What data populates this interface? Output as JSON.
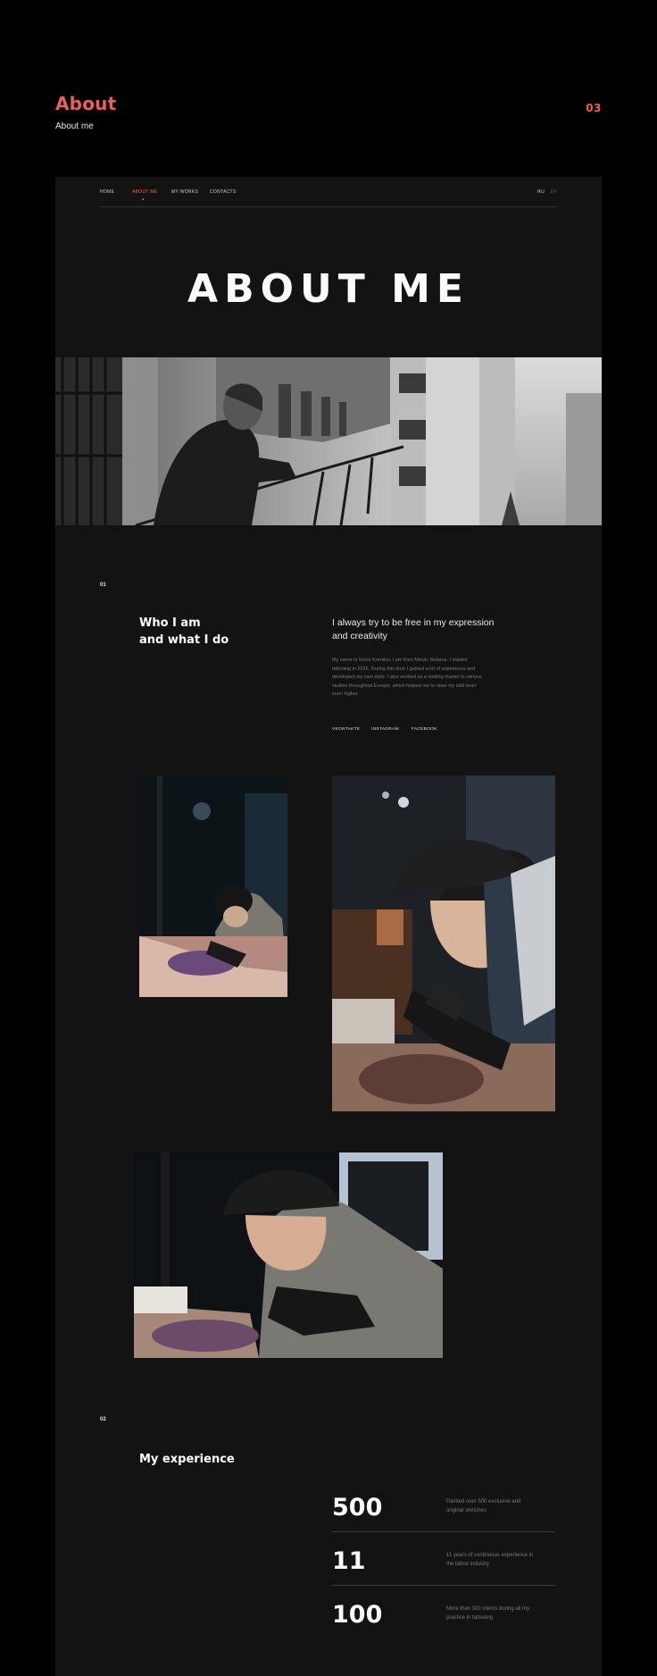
{
  "page": {
    "title": "About",
    "subtitle": "About me",
    "number": "03"
  },
  "nav": {
    "items": [
      "HOME",
      "ABOUT ME",
      "MY WORKS",
      "CONTACTS"
    ],
    "active_index": 1,
    "languages": [
      "RU",
      "EN"
    ]
  },
  "hero": {
    "heading": "ABOUT ME"
  },
  "section1": {
    "number": "01",
    "heading_line1": "Who I am",
    "heading_line2": "and what I do",
    "lead": "I always try to be free in my expression and creativity",
    "body": "My name is Victor Kornilov, I am from Minsk, Belarus. I started tattooing in 2016. During this time I gained a lot of experience and developed my own style. I also worked as a visiting master in various studios throughout Europe, which helped me to raise my skill level even higher.",
    "socials": [
      "VKONTAKTE",
      "INSTAGRAM",
      "FACEBOOK"
    ]
  },
  "section2": {
    "number": "02",
    "heading": "My experience",
    "stats": [
      {
        "value": "500",
        "description": "Painted over 500 exclusive and original sketches"
      },
      {
        "value": "11",
        "description": "11 years of continuous experience in the tattoo industry"
      },
      {
        "value": "100",
        "description": "More than 300 clients during all my practice in tattooing"
      }
    ]
  },
  "colors": {
    "accent": "#e8625c",
    "background": "#000000",
    "panel": "#131313"
  },
  "icons": []
}
